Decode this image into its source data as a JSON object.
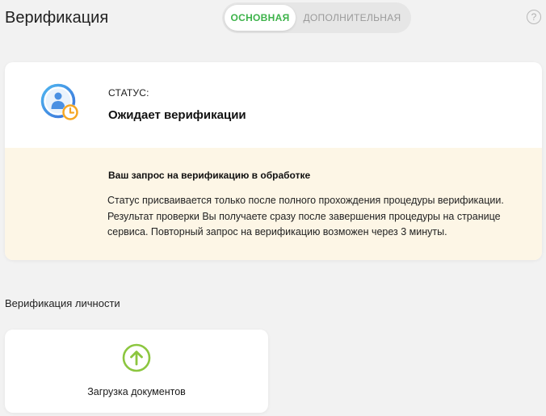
{
  "header": {
    "title": "Верификация",
    "help_symbol": "?"
  },
  "tabs": [
    {
      "label": "ОСНОВНАЯ",
      "active": true
    },
    {
      "label": "ДОПОЛНИТЕЛЬНАЯ",
      "active": false
    }
  ],
  "status": {
    "label": "СТАТУС:",
    "value": "Ожидает верификации",
    "icon": "user-clock-icon"
  },
  "notice": {
    "title": "Ваш запрос на верификацию в обработке",
    "text": "Статус присваивается только после полного прохождения процедуры верификации. Результат проверки Вы получаете сразу после завершения процедуры на странице сервиса. Повторный запрос на верификацию возможен через 3 минуты."
  },
  "identity_section": {
    "title": "Верификация личности",
    "upload_label": "Загрузка документов",
    "upload_icon": "upload-arrow-icon"
  },
  "colors": {
    "accent_green": "#3db34a",
    "upload_green": "#8cc63f",
    "notice_bg": "#fdf6e6",
    "clock_orange": "#f5a623",
    "avatar_blue": "#4a90e2"
  }
}
